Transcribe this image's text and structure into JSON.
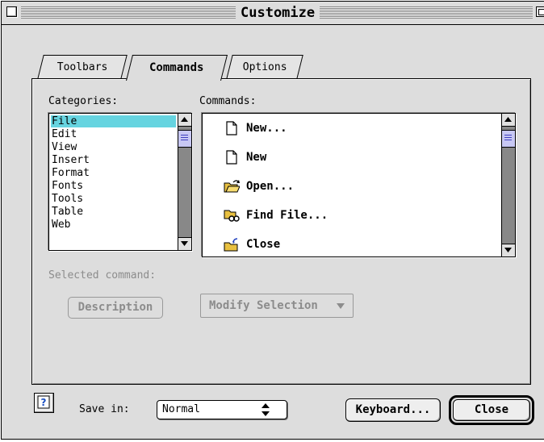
{
  "window": {
    "title": "Customize"
  },
  "tabs": [
    {
      "label": "Toolbars",
      "active": false
    },
    {
      "label": "Commands",
      "active": true
    },
    {
      "label": "Options",
      "active": false
    }
  ],
  "categories": {
    "label": "Categories:",
    "items": [
      "File",
      "Edit",
      "View",
      "Insert",
      "Format",
      "Fonts",
      "Tools",
      "Table",
      "Web"
    ],
    "selected": "File"
  },
  "commands": {
    "label": "Commands:",
    "items": [
      {
        "label": "New...",
        "icon": "new-document-icon"
      },
      {
        "label": "New",
        "icon": "new-document-icon"
      },
      {
        "label": "Open...",
        "icon": "open-folder-icon"
      },
      {
        "label": "Find File...",
        "icon": "find-file-icon"
      },
      {
        "label": "Close",
        "icon": "close-folder-icon"
      }
    ]
  },
  "selected_command": {
    "label": "Selected command:",
    "description_button": "Description",
    "modify_button": "Modify Selection"
  },
  "footer": {
    "help_icon": "help-icon",
    "save_in_label": "Save in:",
    "save_in_value": "Normal",
    "keyboard_button": "Keyboard...",
    "close_button": "Close"
  },
  "colors": {
    "selection": "#66d4e0",
    "scroll_thumb": "#c8c8f4",
    "window_bg": "#dddddd"
  }
}
